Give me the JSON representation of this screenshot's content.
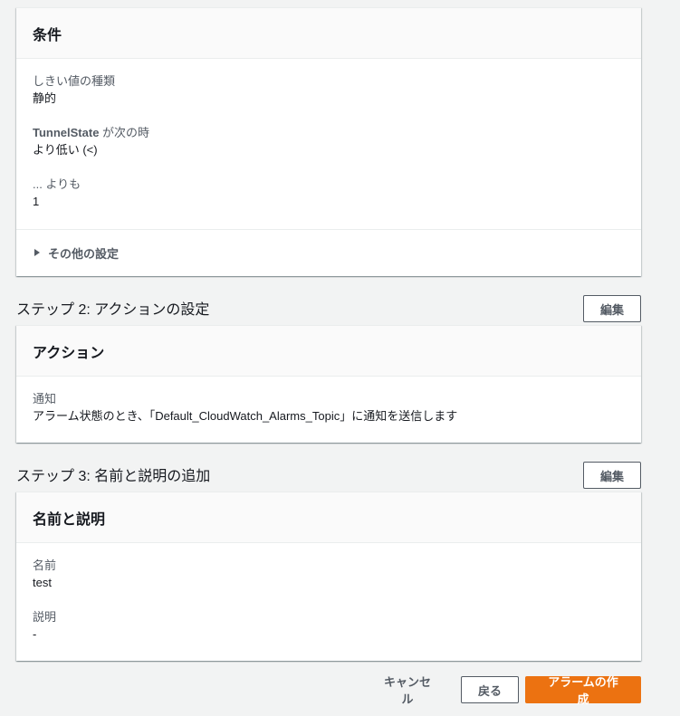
{
  "conditions": {
    "title": "条件",
    "threshold_type_label": "しきい値の種類",
    "threshold_type_value": "静的",
    "metric_name": "TunnelState",
    "metric_suffix": " が次の時",
    "comparison_value": "より低い (<)",
    "than_label": "... よりも",
    "than_value": "1",
    "more_settings_label": "その他の設定"
  },
  "step2": {
    "title": "ステップ 2: アクションの設定",
    "edit_label": "編集",
    "panel_title": "アクション",
    "notification_label": "通知",
    "notification_value": "アラーム状態のとき、「Default_CloudWatch_Alarms_Topic」に通知を送信します"
  },
  "step3": {
    "title": "ステップ 3: 名前と説明の追加",
    "edit_label": "編集",
    "panel_title": "名前と説明",
    "name_label": "名前",
    "name_value": "test",
    "description_label": "説明",
    "description_value": "-"
  },
  "footer": {
    "cancel_label": "キャンセル",
    "back_label": "戻る",
    "create_label": "アラームの作成"
  },
  "colors": {
    "primary": "#ec7211",
    "background": "#f2f3f3"
  }
}
